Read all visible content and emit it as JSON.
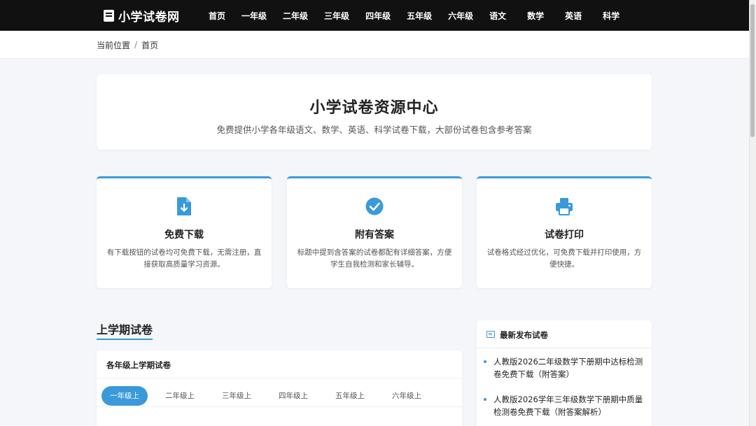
{
  "header": {
    "logo_text": "小学试卷网",
    "nav": [
      "首页",
      "一年级",
      "二年级",
      "三年级",
      "四年级",
      "五年级",
      "六年级",
      "语文",
      "数学",
      "英语",
      "科学"
    ]
  },
  "breadcrumb": {
    "label": "当前位置",
    "separator": "/",
    "current": "首页"
  },
  "hero": {
    "title": "小学试卷资源中心",
    "subtitle": "免费提供小学各年级语文、数学、英语、科学试卷下载，大部份试卷包含参考答案"
  },
  "features": [
    {
      "icon": "file-download-icon",
      "title": "免费下载",
      "desc": "有下载按钮的试卷均可免费下载，无需注册，直接获取高质量学习资源。"
    },
    {
      "icon": "check-circle-icon",
      "title": "附有答案",
      "desc": "标题中提到含答案的试卷都配有详细答案，方便学生自我检测和家长辅导。"
    },
    {
      "icon": "printer-icon",
      "title": "试卷打印",
      "desc": "试卷格式经过优化，可免费下载并打印使用，方便快捷。"
    }
  ],
  "section": {
    "title": "上学期试卷",
    "panel_title": "各年级上学期试卷",
    "tabs": [
      "一年级上",
      "二年级上",
      "三年级上",
      "四年级上",
      "五年级上",
      "六年级上"
    ],
    "active_tab": 0
  },
  "latest": {
    "title": "最新发布试卷",
    "items": [
      "人教版2026二年级数学下册期中达标检测卷免费下载（附答案）",
      "人教版2026学年三年级数学下册期中质量检测卷免费下载（附答案解析）"
    ]
  },
  "colors": {
    "accent": "#3a9ad9",
    "topbar": "#111111"
  }
}
